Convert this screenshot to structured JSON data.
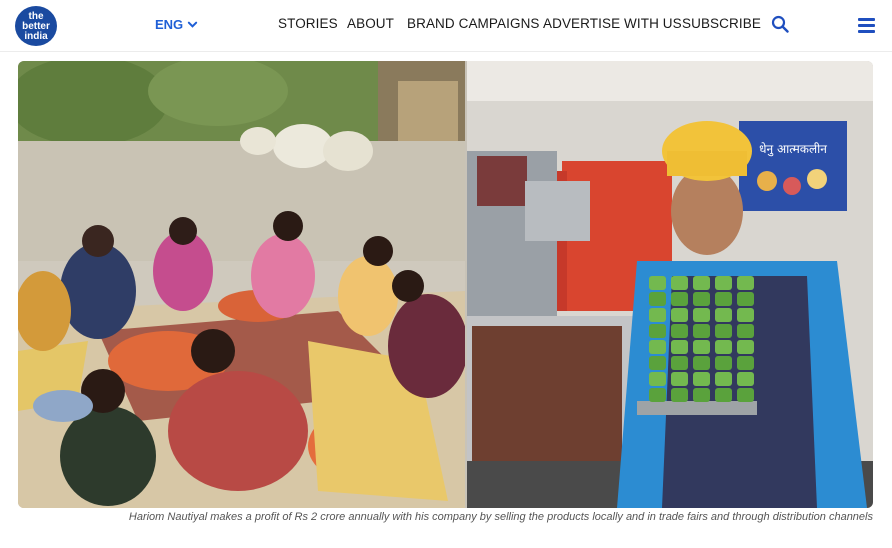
{
  "logo": {
    "line1": "the",
    "line2": "better",
    "line3": "india"
  },
  "language": {
    "label": "ENG"
  },
  "nav": {
    "stories": "STORIES",
    "about": "ABOUT",
    "brand_campaigns": "BRAND CAMPAIGNS",
    "advertise": "ADVERTISE WITH US",
    "subscribe": "SUBSCRIBE"
  },
  "icons": {
    "search": "search-icon",
    "menu": "hamburger-menu-icon",
    "language": "chevron-down-icon"
  },
  "colors": {
    "brand_blue": "#1a4aa0",
    "accent_blue": "#1f5fd6"
  },
  "photos": {
    "right_banner_text": "धेनु आत्मकलीन"
  },
  "caption": "Hariom Nautiyal makes a profit of Rs 2 crore annually with his company by selling the products locally and in trade fairs and through distribution channels"
}
